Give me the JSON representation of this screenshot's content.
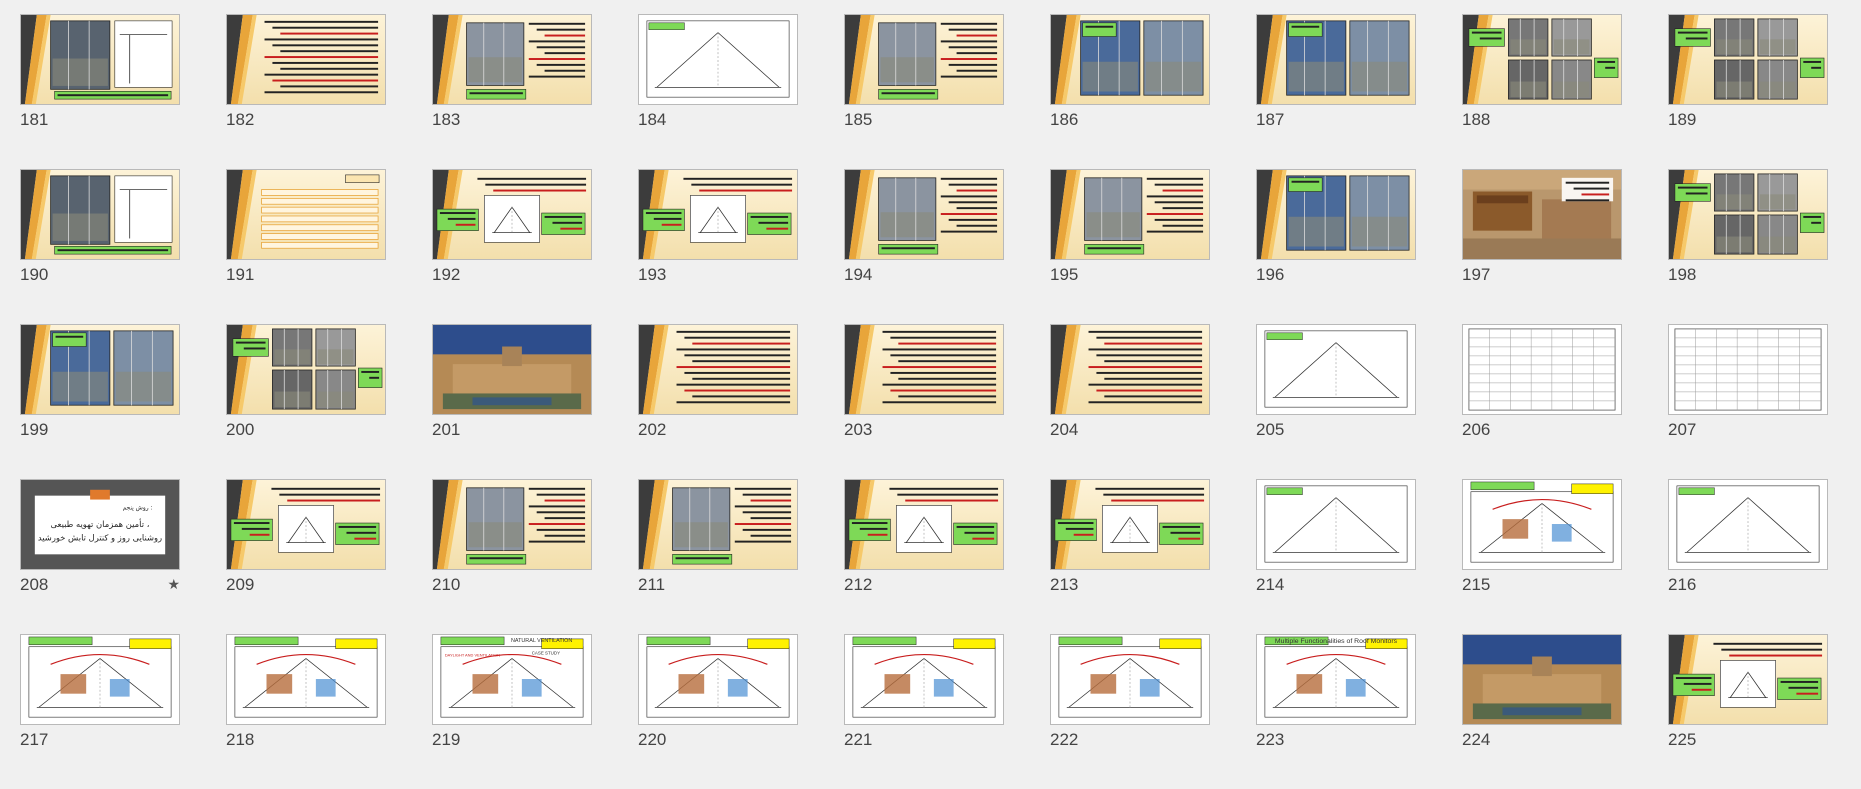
{
  "slides": [
    {
      "num": "181",
      "style": "arch-photo",
      "panel": "left"
    },
    {
      "num": "182",
      "style": "text"
    },
    {
      "num": "183",
      "style": "photo-text"
    },
    {
      "num": "184",
      "style": "drawing"
    },
    {
      "num": "185",
      "style": "photo-text"
    },
    {
      "num": "186",
      "style": "photos"
    },
    {
      "num": "187",
      "style": "photos"
    },
    {
      "num": "188",
      "style": "photos-grid"
    },
    {
      "num": "189",
      "style": "photos-grid"
    },
    {
      "num": "190",
      "style": "arch-photo"
    },
    {
      "num": "191",
      "style": "list"
    },
    {
      "num": "192",
      "style": "diagram-text"
    },
    {
      "num": "193",
      "style": "diagram-text"
    },
    {
      "num": "194",
      "style": "photo-text"
    },
    {
      "num": "195",
      "style": "photo-text"
    },
    {
      "num": "196",
      "style": "photos"
    },
    {
      "num": "197",
      "style": "full-photo"
    },
    {
      "num": "198",
      "style": "photos-grid"
    },
    {
      "num": "199",
      "style": "photos"
    },
    {
      "num": "200",
      "style": "photos-grid"
    },
    {
      "num": "201",
      "style": "courtyard"
    },
    {
      "num": "202",
      "style": "text"
    },
    {
      "num": "203",
      "style": "text"
    },
    {
      "num": "204",
      "style": "text"
    },
    {
      "num": "205",
      "style": "drawing"
    },
    {
      "num": "206",
      "style": "table"
    },
    {
      "num": "207",
      "style": "table"
    },
    {
      "num": "208",
      "style": "section-title",
      "title_line1": "روش پنجم :",
      "title_line2": "تأمین همزمان تهویه طبیعی ،",
      "title_line3": "روشنایی روز و کنترل تابش خورشید",
      "has_star": true
    },
    {
      "num": "209",
      "style": "diagram-text"
    },
    {
      "num": "210",
      "style": "photo-text"
    },
    {
      "num": "211",
      "style": "photo-text"
    },
    {
      "num": "212",
      "style": "diagram-text"
    },
    {
      "num": "213",
      "style": "diagram-text"
    },
    {
      "num": "214",
      "style": "drawing"
    },
    {
      "num": "215",
      "style": "drawing-color"
    },
    {
      "num": "216",
      "style": "drawing"
    },
    {
      "num": "217",
      "style": "drawing-color"
    },
    {
      "num": "218",
      "style": "drawing-color"
    },
    {
      "num": "219",
      "style": "drawing-color",
      "heading": "NATURAL VENTILATION",
      "heading2": "DAYLIGHT AND VENTILATION",
      "heading3": "CASE STUDY"
    },
    {
      "num": "220",
      "style": "drawing-color"
    },
    {
      "num": "221",
      "style": "drawing-color"
    },
    {
      "num": "222",
      "style": "drawing-color"
    },
    {
      "num": "223",
      "style": "drawing-color",
      "heading": "Multiple Functionalities of Roof Monitors"
    },
    {
      "num": "224",
      "style": "courtyard"
    },
    {
      "num": "225",
      "style": "diagram-text"
    }
  ],
  "colors": {
    "slide_bg_top": "#fdf3d8",
    "slide_bg_bottom": "#f3dfac",
    "stripe_orange": "#e8a53a",
    "stripe_dark": "#3c3c3c",
    "label_green": "#7ed957",
    "label_yellow": "#fff200",
    "accent_red": "#c81e1e",
    "section_bg": "#555555"
  }
}
